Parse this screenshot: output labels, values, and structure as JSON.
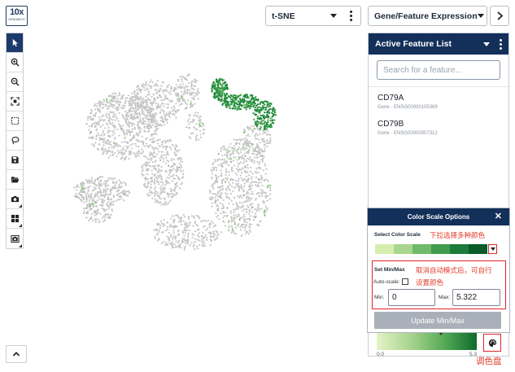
{
  "logo": {
    "line1": "10x",
    "line2": "GENOMICS"
  },
  "toolbar": {
    "tools": [
      "select-arrow",
      "zoom-in",
      "zoom-out",
      "fit-view",
      "rect-select",
      "lasso-select",
      "save",
      "open-folder",
      "camera",
      "layout-grid",
      "screenshot-camera"
    ],
    "active_tool": "select-arrow"
  },
  "projection_dropdown": {
    "label": "t-SNE"
  },
  "mode_dropdown": {
    "label": "Gene/Feature Expression"
  },
  "feature_panel": {
    "title": "Active Feature List",
    "search_placeholder": "Search for a feature...",
    "features": [
      {
        "name": "CD79A",
        "id": "Gene · ENSG00000105369"
      },
      {
        "name": "CD79B",
        "id": "Gene · ENSG00000007312"
      }
    ]
  },
  "color_scale": {
    "title": "Color Scale Options",
    "close": "✕",
    "select_label": "Select Color Scale",
    "swatches": [
      "#d7edae",
      "#a8d68e",
      "#6fba6b",
      "#3f9b4e",
      "#1c7a3a",
      "#0a5a2a"
    ],
    "set_label": "Set Min/Max",
    "auto_label": "Auto-scale:",
    "min_label": "Min:",
    "min_value": "0",
    "max_label": "Max:",
    "max_value": "5.322",
    "update_label": "Update Min/Max"
  },
  "annotations": {
    "dropdown_note": "下拉选择多种颜色",
    "minmax_note_1": "取消自动模式后，可自行",
    "minmax_note_2": "设置颜色",
    "palette_note": "调色盘"
  },
  "legend": {
    "min_tick": "0.0",
    "max_tick": "5.3"
  },
  "colors": {
    "header_navy": "#13305a",
    "cell_gray": "#c6c6c6",
    "highlight_green": "#1f8a3c",
    "annotation_red": "#e0252b"
  }
}
